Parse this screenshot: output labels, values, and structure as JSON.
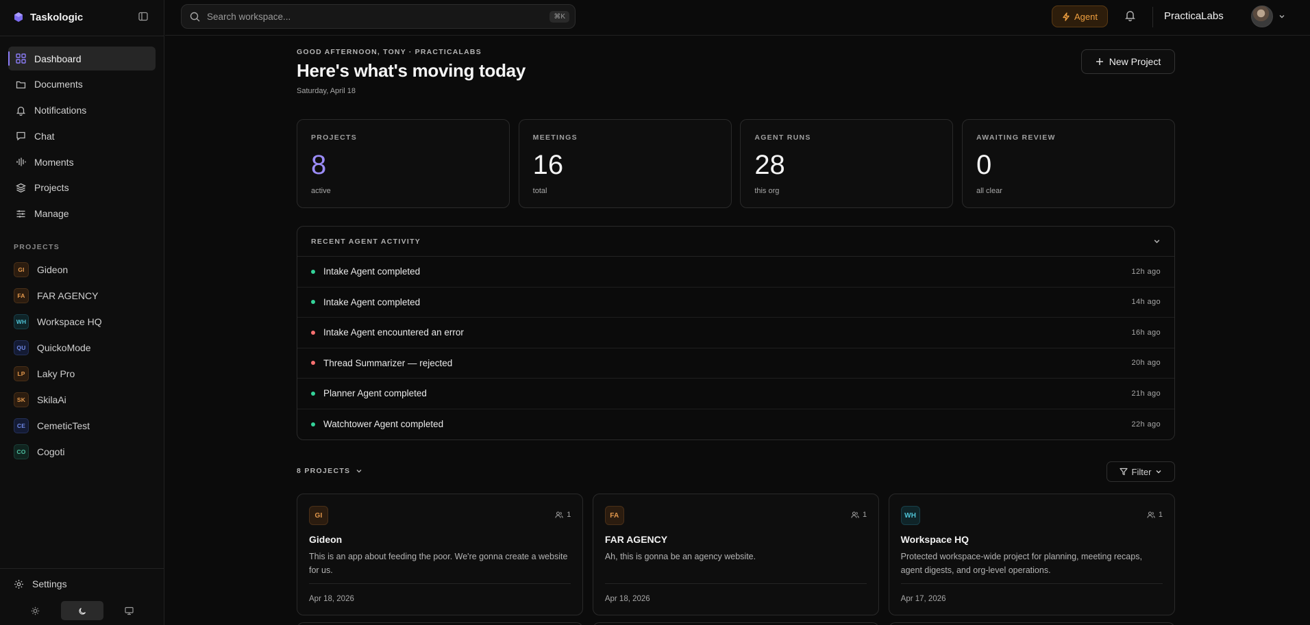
{
  "app": {
    "name": "Taskologic"
  },
  "sidebar": {
    "nav": [
      {
        "label": "Dashboard",
        "icon": "grid-icon",
        "active": true
      },
      {
        "label": "Documents",
        "icon": "folder-icon"
      },
      {
        "label": "Notifications",
        "icon": "bell-icon"
      },
      {
        "label": "Chat",
        "icon": "chat-bubble-icon"
      },
      {
        "label": "Moments",
        "icon": "waveform-icon"
      },
      {
        "label": "Projects",
        "icon": "layers-icon"
      },
      {
        "label": "Manage",
        "icon": "sliders-icon"
      }
    ],
    "projects_header": "PROJECTS",
    "projects": [
      {
        "abbr": "GI",
        "name": "Gideon",
        "color": "orange"
      },
      {
        "abbr": "FA",
        "name": "FAR AGENCY",
        "color": "orange"
      },
      {
        "abbr": "WH",
        "name": "Workspace HQ",
        "color": "cyan"
      },
      {
        "abbr": "QU",
        "name": "QuickoMode",
        "color": "blue"
      },
      {
        "abbr": "LP",
        "name": "Laky Pro",
        "color": "orange"
      },
      {
        "abbr": "SK",
        "name": "SkilaAi",
        "color": "orange"
      },
      {
        "abbr": "CE",
        "name": "CemeticTest",
        "color": "blue"
      },
      {
        "abbr": "CO",
        "name": "Cogoti",
        "color": "teal"
      }
    ],
    "settings_label": "Settings",
    "theme_modes": [
      "light",
      "dark",
      "system"
    ],
    "theme_active": "dark"
  },
  "topbar": {
    "search_placeholder": "Search workspace...",
    "shortcut": "⌘K",
    "agent_label": "Agent",
    "org_name": "PracticaLabs"
  },
  "main": {
    "greeting": "GOOD AFTERNOON, TONY · PRACTICALABS",
    "title": "Here's what's moving today",
    "date": "Saturday, April 18",
    "new_project_label": "New Project",
    "stats": [
      {
        "label": "PROJECTS",
        "value": "8",
        "sub": "active",
        "accent": true
      },
      {
        "label": "MEETINGS",
        "value": "16",
        "sub": "total"
      },
      {
        "label": "AGENT RUNS",
        "value": "28",
        "sub": "this org"
      },
      {
        "label": "AWAITING REVIEW",
        "value": "0",
        "sub": "all clear"
      }
    ],
    "activity": {
      "title": "RECENT AGENT ACTIVITY",
      "items": [
        {
          "text": "Intake Agent completed",
          "time": "12h  ago",
          "status": "ok"
        },
        {
          "text": "Intake Agent completed",
          "time": "14h  ago",
          "status": "ok"
        },
        {
          "text": "Intake Agent encountered an error",
          "time": "16h  ago",
          "status": "error"
        },
        {
          "text": "Thread Summarizer — rejected",
          "time": "20h  ago",
          "status": "error"
        },
        {
          "text": "Planner Agent completed",
          "time": "21h  ago",
          "status": "ok"
        },
        {
          "text": "Watchtower Agent completed",
          "time": "22h  ago",
          "status": "ok"
        }
      ]
    },
    "projects_count_label": "8 PROJECTS",
    "filter_label": "Filter",
    "project_cards": [
      {
        "abbr": "GI",
        "color": "orange",
        "members": "1",
        "name": "Gideon",
        "desc": "This is an app about feeding the poor. We're gonna create a website for us.",
        "date": "Apr 18, 2026"
      },
      {
        "abbr": "FA",
        "color": "orange",
        "members": "1",
        "name": "FAR AGENCY",
        "desc": "Ah, this is gonna be an agency website.",
        "date": "Apr 18, 2026"
      },
      {
        "abbr": "WH",
        "color": "cyan",
        "members": "1",
        "name": "Workspace HQ",
        "desc": "Protected workspace-wide project for planning, meeting recaps, agent digests, and org-level operations.",
        "date": "Apr 17, 2026"
      }
    ]
  }
}
